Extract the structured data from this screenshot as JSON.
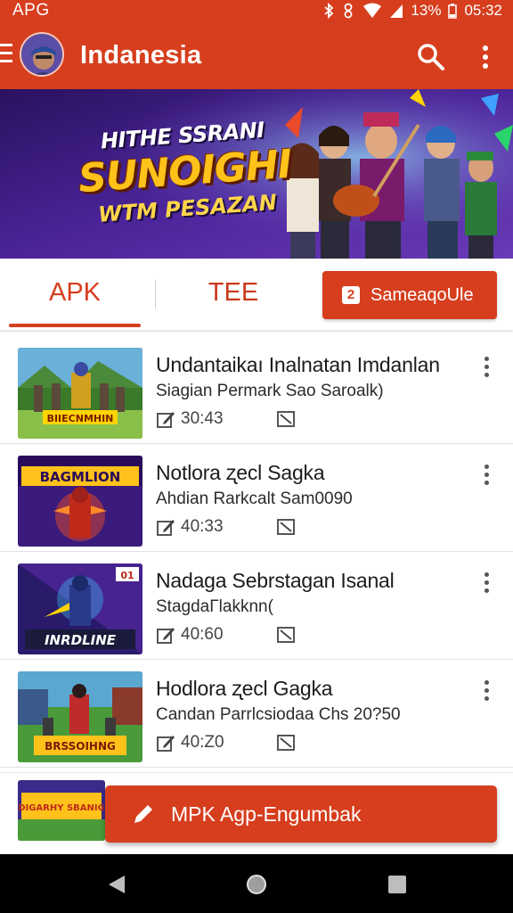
{
  "status_bar": {
    "carrier": "APG",
    "battery": "13%",
    "time": "05:32",
    "icons": [
      "bluetooth-icon",
      "vibrate-icon",
      "wifi-icon",
      "signal-icon",
      "battery-icon"
    ]
  },
  "app_bar": {
    "title": "Indanesia",
    "icons": [
      "menu-icon",
      "avatar",
      "search-icon",
      "more-vert-icon"
    ],
    "color": "#d63e1e"
  },
  "banner": {
    "line1": "HITHE SSRANI",
    "line2": "SUNOIGHI",
    "line3": "WTM PESAZAN"
  },
  "tabs": {
    "items": [
      {
        "label": "APK",
        "active": true
      },
      {
        "label": "TEE",
        "active": false
      }
    ],
    "action_label": "SameaqoUle",
    "action_icon_text": "2"
  },
  "list": {
    "items": [
      {
        "title": "Undantaikaı Inalnatan Imdanlan",
        "subtitle": "Siagian Permark Sao Saroalk)",
        "duration": "30:43",
        "thumb_label": "BIIECNMHIN"
      },
      {
        "title": "Notlora ʐecl Sagka",
        "subtitle": "Ahdian Rarkcalt Sam0090",
        "duration": "40:33",
        "thumb_label": "BAGMLION"
      },
      {
        "title": "Nadaga Sebrstagan Isanal",
        "subtitle": "StagdaΓlakknn(",
        "duration": "40:60",
        "thumb_label": "INRDLINE",
        "thumb_corner": "01"
      },
      {
        "title": "Hodlora ʐecl Gagka",
        "subtitle": "Candan Parrlcsiodaa Chs 20?50",
        "duration": "40:Z0",
        "thumb_label": "BRSSOIHNG"
      }
    ]
  },
  "bottom": {
    "thumb_label": "DIGARHY SBANIG",
    "fab_label": "MPK Agp-Engumbak"
  },
  "accent": "#d63e1e"
}
